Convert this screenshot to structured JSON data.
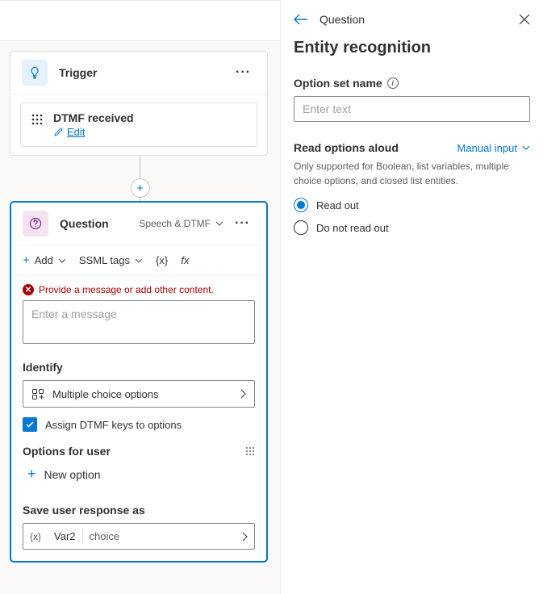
{
  "trigger": {
    "title": "Trigger",
    "event_title": "DTMF received",
    "edit_label": "Edit"
  },
  "question": {
    "title": "Question",
    "mode": "Speech & DTMF",
    "toolbar": {
      "add": "Add",
      "ssml": "SSML tags",
      "varhint": "{x}",
      "fx": "fx"
    },
    "error": "Provide a message or add other content.",
    "msg_placeholder": "Enter a message",
    "identify_label": "Identify",
    "identify_value": "Multiple choice options",
    "assign_keys": "Assign DTMF keys to options",
    "options_label": "Options for user",
    "new_option": "New option",
    "save_label": "Save user response as",
    "save_var": "Var2",
    "save_type": "choice"
  },
  "panel": {
    "back_label": "Question",
    "heading": "Entity recognition",
    "option_set_label": "Option set name",
    "option_set_placeholder": "Enter text",
    "read_label": "Read options aloud",
    "manual": "Manual input",
    "hint": "Only supported for Boolean, list variables, multiple choice options, and closed list entities.",
    "radio_yes": "Read out",
    "radio_no": "Do not read out"
  }
}
